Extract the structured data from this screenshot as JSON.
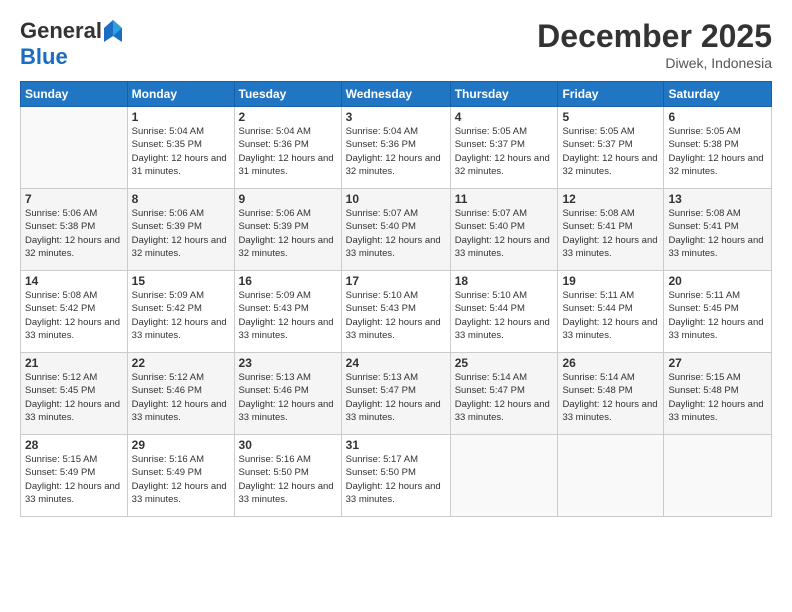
{
  "header": {
    "logo_line1": "General",
    "logo_line2": "Blue",
    "month": "December 2025",
    "location": "Diwek, Indonesia"
  },
  "weekdays": [
    "Sunday",
    "Monday",
    "Tuesday",
    "Wednesday",
    "Thursday",
    "Friday",
    "Saturday"
  ],
  "weeks": [
    [
      {
        "day": "",
        "sunrise": "",
        "sunset": "",
        "daylight": ""
      },
      {
        "day": "1",
        "sunrise": "Sunrise: 5:04 AM",
        "sunset": "Sunset: 5:35 PM",
        "daylight": "Daylight: 12 hours and 31 minutes."
      },
      {
        "day": "2",
        "sunrise": "Sunrise: 5:04 AM",
        "sunset": "Sunset: 5:36 PM",
        "daylight": "Daylight: 12 hours and 31 minutes."
      },
      {
        "day": "3",
        "sunrise": "Sunrise: 5:04 AM",
        "sunset": "Sunset: 5:36 PM",
        "daylight": "Daylight: 12 hours and 32 minutes."
      },
      {
        "day": "4",
        "sunrise": "Sunrise: 5:05 AM",
        "sunset": "Sunset: 5:37 PM",
        "daylight": "Daylight: 12 hours and 32 minutes."
      },
      {
        "day": "5",
        "sunrise": "Sunrise: 5:05 AM",
        "sunset": "Sunset: 5:37 PM",
        "daylight": "Daylight: 12 hours and 32 minutes."
      },
      {
        "day": "6",
        "sunrise": "Sunrise: 5:05 AM",
        "sunset": "Sunset: 5:38 PM",
        "daylight": "Daylight: 12 hours and 32 minutes."
      }
    ],
    [
      {
        "day": "7",
        "sunrise": "Sunrise: 5:06 AM",
        "sunset": "Sunset: 5:38 PM",
        "daylight": "Daylight: 12 hours and 32 minutes."
      },
      {
        "day": "8",
        "sunrise": "Sunrise: 5:06 AM",
        "sunset": "Sunset: 5:39 PM",
        "daylight": "Daylight: 12 hours and 32 minutes."
      },
      {
        "day": "9",
        "sunrise": "Sunrise: 5:06 AM",
        "sunset": "Sunset: 5:39 PM",
        "daylight": "Daylight: 12 hours and 32 minutes."
      },
      {
        "day": "10",
        "sunrise": "Sunrise: 5:07 AM",
        "sunset": "Sunset: 5:40 PM",
        "daylight": "Daylight: 12 hours and 33 minutes."
      },
      {
        "day": "11",
        "sunrise": "Sunrise: 5:07 AM",
        "sunset": "Sunset: 5:40 PM",
        "daylight": "Daylight: 12 hours and 33 minutes."
      },
      {
        "day": "12",
        "sunrise": "Sunrise: 5:08 AM",
        "sunset": "Sunset: 5:41 PM",
        "daylight": "Daylight: 12 hours and 33 minutes."
      },
      {
        "day": "13",
        "sunrise": "Sunrise: 5:08 AM",
        "sunset": "Sunset: 5:41 PM",
        "daylight": "Daylight: 12 hours and 33 minutes."
      }
    ],
    [
      {
        "day": "14",
        "sunrise": "Sunrise: 5:08 AM",
        "sunset": "Sunset: 5:42 PM",
        "daylight": "Daylight: 12 hours and 33 minutes."
      },
      {
        "day": "15",
        "sunrise": "Sunrise: 5:09 AM",
        "sunset": "Sunset: 5:42 PM",
        "daylight": "Daylight: 12 hours and 33 minutes."
      },
      {
        "day": "16",
        "sunrise": "Sunrise: 5:09 AM",
        "sunset": "Sunset: 5:43 PM",
        "daylight": "Daylight: 12 hours and 33 minutes."
      },
      {
        "day": "17",
        "sunrise": "Sunrise: 5:10 AM",
        "sunset": "Sunset: 5:43 PM",
        "daylight": "Daylight: 12 hours and 33 minutes."
      },
      {
        "day": "18",
        "sunrise": "Sunrise: 5:10 AM",
        "sunset": "Sunset: 5:44 PM",
        "daylight": "Daylight: 12 hours and 33 minutes."
      },
      {
        "day": "19",
        "sunrise": "Sunrise: 5:11 AM",
        "sunset": "Sunset: 5:44 PM",
        "daylight": "Daylight: 12 hours and 33 minutes."
      },
      {
        "day": "20",
        "sunrise": "Sunrise: 5:11 AM",
        "sunset": "Sunset: 5:45 PM",
        "daylight": "Daylight: 12 hours and 33 minutes."
      }
    ],
    [
      {
        "day": "21",
        "sunrise": "Sunrise: 5:12 AM",
        "sunset": "Sunset: 5:45 PM",
        "daylight": "Daylight: 12 hours and 33 minutes."
      },
      {
        "day": "22",
        "sunrise": "Sunrise: 5:12 AM",
        "sunset": "Sunset: 5:46 PM",
        "daylight": "Daylight: 12 hours and 33 minutes."
      },
      {
        "day": "23",
        "sunrise": "Sunrise: 5:13 AM",
        "sunset": "Sunset: 5:46 PM",
        "daylight": "Daylight: 12 hours and 33 minutes."
      },
      {
        "day": "24",
        "sunrise": "Sunrise: 5:13 AM",
        "sunset": "Sunset: 5:47 PM",
        "daylight": "Daylight: 12 hours and 33 minutes."
      },
      {
        "day": "25",
        "sunrise": "Sunrise: 5:14 AM",
        "sunset": "Sunset: 5:47 PM",
        "daylight": "Daylight: 12 hours and 33 minutes."
      },
      {
        "day": "26",
        "sunrise": "Sunrise: 5:14 AM",
        "sunset": "Sunset: 5:48 PM",
        "daylight": "Daylight: 12 hours and 33 minutes."
      },
      {
        "day": "27",
        "sunrise": "Sunrise: 5:15 AM",
        "sunset": "Sunset: 5:48 PM",
        "daylight": "Daylight: 12 hours and 33 minutes."
      }
    ],
    [
      {
        "day": "28",
        "sunrise": "Sunrise: 5:15 AM",
        "sunset": "Sunset: 5:49 PM",
        "daylight": "Daylight: 12 hours and 33 minutes."
      },
      {
        "day": "29",
        "sunrise": "Sunrise: 5:16 AM",
        "sunset": "Sunset: 5:49 PM",
        "daylight": "Daylight: 12 hours and 33 minutes."
      },
      {
        "day": "30",
        "sunrise": "Sunrise: 5:16 AM",
        "sunset": "Sunset: 5:50 PM",
        "daylight": "Daylight: 12 hours and 33 minutes."
      },
      {
        "day": "31",
        "sunrise": "Sunrise: 5:17 AM",
        "sunset": "Sunset: 5:50 PM",
        "daylight": "Daylight: 12 hours and 33 minutes."
      },
      {
        "day": "",
        "sunrise": "",
        "sunset": "",
        "daylight": ""
      },
      {
        "day": "",
        "sunrise": "",
        "sunset": "",
        "daylight": ""
      },
      {
        "day": "",
        "sunrise": "",
        "sunset": "",
        "daylight": ""
      }
    ]
  ]
}
